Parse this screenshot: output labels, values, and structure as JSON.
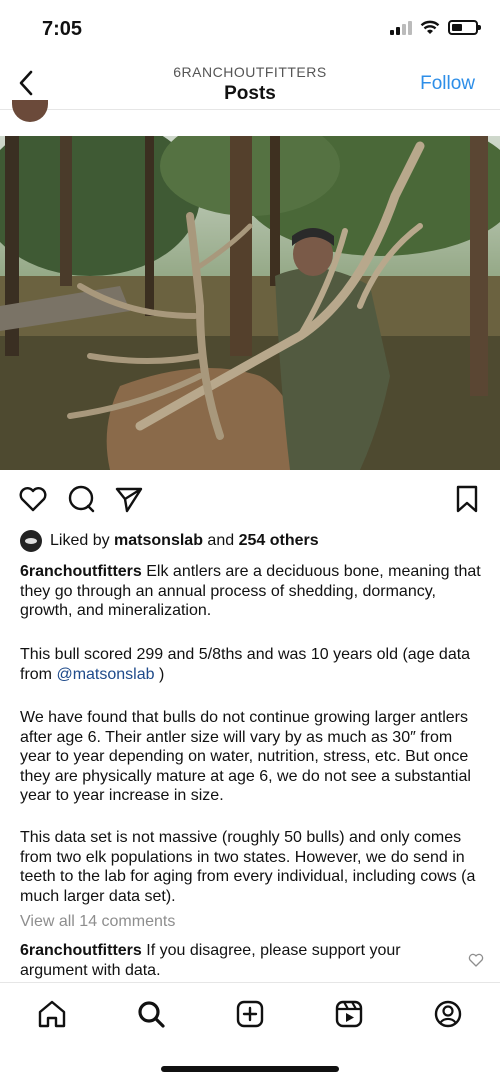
{
  "status_bar": {
    "time": "7:05"
  },
  "header": {
    "username": "6RANCHOUTFITTERS",
    "title": "Posts",
    "follow_label": "Follow"
  },
  "post": {
    "photo_icon": "elk-hunter-photo",
    "likes": {
      "prefix": "Liked by",
      "liker": "matsonslab",
      "and": "and",
      "others": "254 others"
    },
    "caption": {
      "username": "6ranchoutfitters",
      "paragraph_1": "Elk antlers are a deciduous bone, meaning that they go through an annual process of shedding, dormancy, growth, and mineralization.",
      "paragraph_2_text": "This bull scored 299 and 5/8ths and was 10 years old (age data from",
      "paragraph_2_mention": "@matsonslab",
      "paragraph_2_end": ")",
      "paragraph_3": "We have found that bulls do not continue growing larger antlers after age 6. Their antler size will vary by as much as 30″ from year to year depending on water, nutrition, stress, etc. But once they are physically mature at age 6, we do not see a substantial year to year increase in size.",
      "paragraph_4": "This data set is not massive (roughly 50 bulls) and only comes from two elk populations in two states. However, we do send in teeth to the lab for aging from every individual, including cows (a much larger data set)."
    },
    "view_comments": "View all 14 comments",
    "comment": {
      "username": "6ranchoutfitters",
      "text": "If you disagree, please support your argument with data."
    }
  },
  "colors": {
    "accent": "#2d8ee8",
    "mention": "#1e4a8a",
    "muted": "#8e8e8e"
  }
}
